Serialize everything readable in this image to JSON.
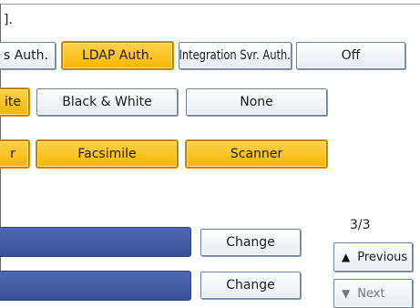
{
  "top_hint": "].",
  "auth_row": {
    "partial": "s Auth.",
    "ldap": "LDAP Auth.",
    "integration": "Integration Svr. Auth.",
    "off": "Off"
  },
  "color_row": {
    "partial": "ite",
    "black_white": "Black & White",
    "none": "None"
  },
  "function_row": {
    "partial": "r",
    "facsimile": "Facsimile",
    "scanner": "Scanner"
  },
  "change_label": "Change",
  "pagination": {
    "indicator": "3/3",
    "previous": "Previous",
    "next": "Next",
    "up_icon": "▲",
    "down_icon": "▼"
  }
}
